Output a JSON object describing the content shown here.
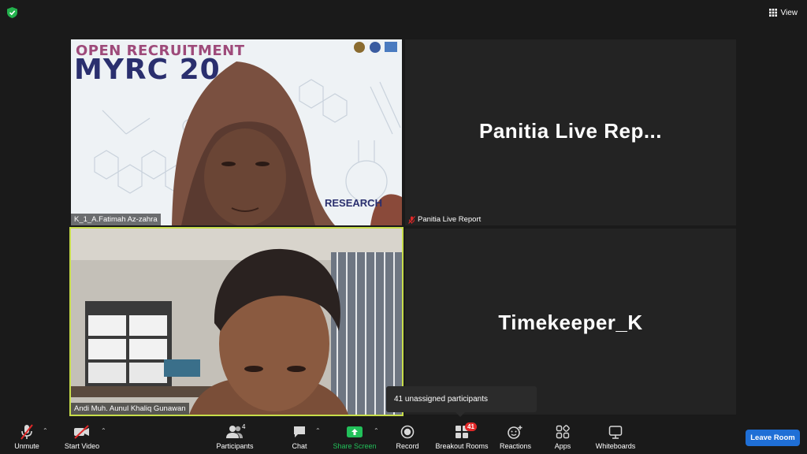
{
  "window": {
    "view_label": "View"
  },
  "tiles": [
    {
      "name_tag": "K_1_A.Fatimah Az-zahra",
      "video": true,
      "poster": {
        "line1": "OPEN RECRUITMENT",
        "line2": "MYRC 20",
        "corner": "RESEARCH"
      }
    },
    {
      "name_tag": "Panitia Live Report",
      "display_name": "Panitia  Live  Rep...",
      "muted": true
    },
    {
      "name_tag": "Andi Muh. Aunul Khaliq Gunawan",
      "video": true,
      "active_speaker": true
    },
    {
      "display_name": "Timekeeper_K"
    }
  ],
  "tooltip": {
    "text": "41 unassigned participants"
  },
  "toolbar": {
    "unmute": "Unmute",
    "start_video": "Start Video",
    "participants": "Participants",
    "participants_count": "4",
    "chat": "Chat",
    "share_screen": "Share Screen",
    "record": "Record",
    "breakout_rooms": "Breakout Rooms",
    "breakout_badge": "41",
    "reactions": "Reactions",
    "apps": "Apps",
    "whiteboards": "Whiteboards",
    "leave": "Leave Room"
  },
  "colors": {
    "background": "#1a1a1a",
    "tile": "#232323",
    "active_speaker_border": "#c7dd4a",
    "share_green": "#22c05a",
    "leave_blue": "#1f6fd6",
    "badge_red": "#e02828",
    "security_green": "#23b14d"
  }
}
